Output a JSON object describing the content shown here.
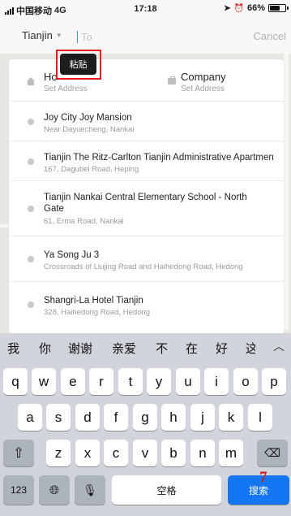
{
  "status_bar": {
    "carrier": "中国移动",
    "network": "4G",
    "time": "17:18",
    "battery": "66%",
    "battery_level": 0.66
  },
  "header": {
    "city": "Tianjin",
    "to_placeholder": "To",
    "cancel_label": "Cancel"
  },
  "paste_tooltip": {
    "label": "粘贴"
  },
  "shortcuts": {
    "home": {
      "label": "Ho",
      "sub": "Set Address"
    },
    "company": {
      "label": "Company",
      "sub": "Set Address"
    }
  },
  "results": [
    {
      "title": "Joy City Joy Mansion",
      "address": "Near Dayuecheng, Nankai"
    },
    {
      "title": "Tianjin The Ritz-Carlton Tianjin Administrative Apartment",
      "address": "167, Dagubei Road, Heping"
    },
    {
      "title": "Tianjin Nankai Central Elementary School - North Gate",
      "address": "61, Erma Road, Nankai"
    },
    {
      "title": "Ya Song Ju 3",
      "address": "Crossroads of Liujing Road and Haihedong Road, Hedong"
    },
    {
      "title": "Shangri-La Hotel Tianjin",
      "address": "328, Haihedong Road, Hedong"
    }
  ],
  "keyboard": {
    "candidates": [
      "我",
      "你",
      "谢谢",
      "亲爱",
      "不",
      "在",
      "好",
      "这"
    ],
    "row1": [
      "q",
      "w",
      "e",
      "r",
      "t",
      "y",
      "u",
      "i",
      "o",
      "p"
    ],
    "row2": [
      "a",
      "s",
      "d",
      "f",
      "g",
      "h",
      "j",
      "k",
      "l"
    ],
    "row3": [
      "z",
      "x",
      "c",
      "v",
      "b",
      "n",
      "m"
    ],
    "num_label": "123",
    "space_label": "空格",
    "search_label": "搜索"
  },
  "annotation": "7"
}
